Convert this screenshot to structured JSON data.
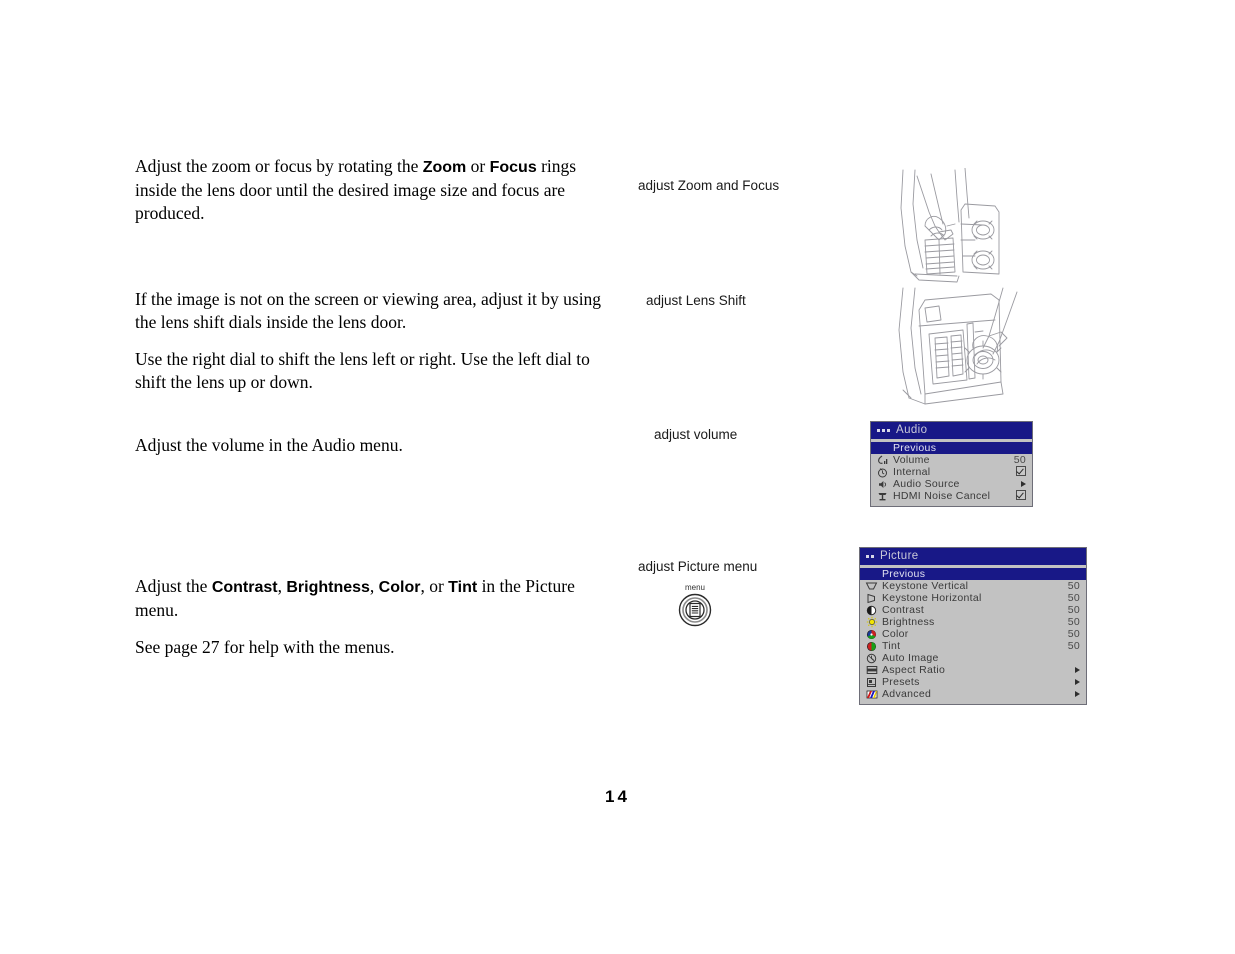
{
  "document": {
    "page_number": "14"
  },
  "sections": [
    {
      "id": "zoom-focus",
      "paragraphs": [
        {
          "runs": [
            {
              "text": "Adjust the zoom or focus by rotating the ",
              "bold": false
            },
            {
              "text": "Zoom",
              "bold": true
            },
            {
              "text": " or ",
              "bold": false
            },
            {
              "text": "Focus",
              "bold": true
            },
            {
              "text": " rings inside the lens door until the desired image size and focus are produced.",
              "bold": false
            }
          ]
        }
      ],
      "caption": "adjust Zoom and Focus"
    },
    {
      "id": "lens-shift",
      "paragraphs": [
        {
          "runs": [
            {
              "text": "If the image is not on the screen or viewing area, adjust it by using the lens shift dials inside the lens door.",
              "bold": false
            }
          ]
        },
        {
          "runs": [
            {
              "text": "Use the right dial to shift the lens left or right. Use the left dial to shift the lens up or down.",
              "bold": false
            }
          ]
        }
      ],
      "caption": "adjust Lens Shift"
    },
    {
      "id": "volume",
      "paragraphs": [
        {
          "runs": [
            {
              "text": "Adjust the volume in the Audio menu.",
              "bold": false
            }
          ]
        }
      ],
      "caption": "adjust volume"
    },
    {
      "id": "picture",
      "paragraphs": [
        {
          "runs": [
            {
              "text": "Adjust the ",
              "bold": false
            },
            {
              "text": "Contrast",
              "bold": true
            },
            {
              "text": ", ",
              "bold": false
            },
            {
              "text": "Brightness",
              "bold": true
            },
            {
              "text": ", ",
              "bold": false
            },
            {
              "text": "Color",
              "bold": true
            },
            {
              "text": ", or ",
              "bold": false
            },
            {
              "text": "Tint",
              "bold": true
            },
            {
              "text": " in the Picture menu.",
              "bold": false
            }
          ]
        },
        {
          "runs": [
            {
              "text": "See page 27 for help with the menus.",
              "bold": false
            }
          ]
        }
      ],
      "caption": "adjust Picture menu",
      "button_label": "menu"
    }
  ],
  "audio_menu": {
    "title": "Audio",
    "title_dots": 3,
    "rows": [
      {
        "label": "Previous",
        "value": "",
        "value_type": "none",
        "icon": "none",
        "selected": true
      },
      {
        "label": "Volume",
        "value": "50",
        "value_type": "number",
        "icon": "volume-icon",
        "selected": false
      },
      {
        "label": "Internal",
        "value": "",
        "value_type": "checkbox",
        "icon": "clock-icon",
        "selected": false
      },
      {
        "label": "Audio Source",
        "value": "",
        "value_type": "arrow",
        "icon": "speaker-icon",
        "selected": false
      },
      {
        "label": "HDMI Noise Cancel",
        "value": "",
        "value_type": "checkbox",
        "icon": "hdmi-icon",
        "selected": false
      }
    ],
    "colors": {
      "title_bar": "#181887",
      "body": "#c2c2c2",
      "highlight": "#181887"
    }
  },
  "picture_menu": {
    "title": "Picture",
    "title_dots": 2,
    "rows": [
      {
        "label": "Previous",
        "value": "",
        "value_type": "none",
        "icon": "none",
        "selected": true
      },
      {
        "label": "Keystone Vertical",
        "value": "50",
        "value_type": "number",
        "icon": "keystone-vertical-icon",
        "selected": false
      },
      {
        "label": "Keystone Horizontal",
        "value": "50",
        "value_type": "number",
        "icon": "keystone-horizontal-icon",
        "selected": false
      },
      {
        "label": "Contrast",
        "value": "50",
        "value_type": "number",
        "icon": "contrast-icon",
        "selected": false
      },
      {
        "label": "Brightness",
        "value": "50",
        "value_type": "number",
        "icon": "brightness-icon",
        "selected": false
      },
      {
        "label": "Color",
        "value": "50",
        "value_type": "number",
        "icon": "color-icon",
        "selected": false
      },
      {
        "label": "Tint",
        "value": "50",
        "value_type": "number",
        "icon": "tint-icon",
        "selected": false
      },
      {
        "label": "Auto Image",
        "value": "",
        "value_type": "none",
        "icon": "auto-image-icon",
        "selected": false
      },
      {
        "label": "Aspect Ratio",
        "value": "",
        "value_type": "arrow",
        "icon": "aspect-ratio-icon",
        "selected": false
      },
      {
        "label": "Presets",
        "value": "",
        "value_type": "arrow",
        "icon": "presets-icon",
        "selected": false
      },
      {
        "label": "Advanced",
        "value": "",
        "value_type": "arrow",
        "icon": "advanced-icon",
        "selected": false
      }
    ],
    "colors": {
      "title_bar": "#181887",
      "body": "#c2c2c2",
      "highlight": "#181887"
    }
  },
  "illustrations": [
    {
      "id": "zoom-focus-illustration",
      "alt": "hand adjusting zoom and focus rings inside lens door"
    },
    {
      "id": "lens-shift-illustration",
      "alt": "hand adjusting lens shift dials inside lens door"
    }
  ]
}
